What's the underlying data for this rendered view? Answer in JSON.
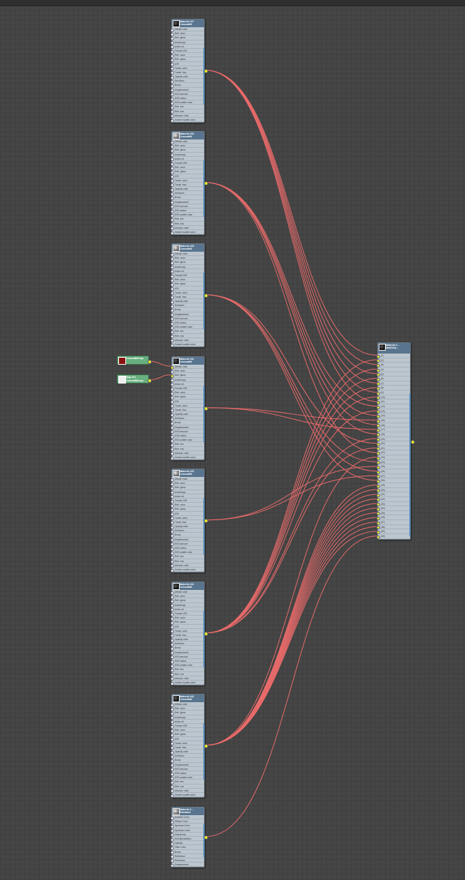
{
  "wire_color": "#e86a6a",
  "corona_slots": [
    "Diffuse color",
    "Refl. color",
    "Refl. gloss",
    "Anisotropy",
    "Aniso rot.",
    "Fresnel IOR",
    "Refr. color",
    "Refr. gloss",
    "IOR",
    "Transl. color",
    "Transl. frac.",
    "Opacity color",
    "Self-illum",
    "Bump",
    "Displacement",
    "SSS amount",
    "SSS radius",
    "SSS scatter color",
    "Refl. env",
    "Refr. env",
    "Absorpt. color",
    "Volume scatter color"
  ],
  "standard_slots": [
    "Ambient Color",
    "Diffuse Color",
    "Specular Color",
    "Specular Level",
    "Glossiness",
    "Self-Illumination",
    "Opacity",
    "Filter Color",
    "Bump",
    "Reflection",
    "Refraction",
    "Displacement"
  ],
  "materials": [
    {
      "name": "Material #27",
      "type": "CoronaMtl",
      "slots": "corona",
      "thumb": "dark"
    },
    {
      "name": "Material #26",
      "type": "CoronaMtl",
      "slots": "corona",
      "thumb": "light"
    },
    {
      "name": "Material #28",
      "type": "CoronaMtl",
      "slots": "corona",
      "thumb": "light"
    },
    {
      "name": "Material #31",
      "type": "CoronaMtl",
      "slots": "corona",
      "thumb": "dark"
    },
    {
      "name": "Material #25",
      "type": "CoronaMtl",
      "slots": "corona",
      "thumb": "light"
    },
    {
      "name": "Material #41",
      "type": "CoronaMtl",
      "slots": "corona",
      "thumb": "dark"
    },
    {
      "name": "Material #42",
      "type": "CoronaMtl",
      "slots": "corona",
      "thumb": "dark"
    },
    {
      "name": "Material #...",
      "type": "Standard",
      "slots": "standard",
      "thumb": "light"
    }
  ],
  "bitmaps": [
    {
      "name": "",
      "type": "CoronaBitmap",
      "thumb_color": "#8a1010",
      "target_slot": 0
    },
    {
      "name": "Map #31",
      "type": "CoronaBitmap",
      "thumb_color": "#eeeeee",
      "target_slot": 2
    }
  ],
  "multi": {
    "name": "Material #...",
    "type": "MultiSub...",
    "slot_count": 40
  },
  "connections": [
    [
      0,
      [
        1,
        3,
        5,
        7,
        9,
        11
      ]
    ],
    [
      1,
      [
        12,
        14,
        16,
        18,
        22
      ]
    ],
    [
      2,
      [
        20,
        24,
        26,
        28
      ]
    ],
    [
      3,
      [
        15,
        17
      ]
    ],
    [
      4,
      [
        25,
        27
      ]
    ],
    [
      5,
      [
        2,
        4,
        6,
        8,
        10,
        13,
        19,
        21
      ]
    ],
    [
      6,
      [
        23,
        29,
        30,
        31,
        32,
        33,
        34,
        35,
        36,
        37,
        38,
        39
      ]
    ],
    [
      7,
      [
        40
      ]
    ]
  ]
}
